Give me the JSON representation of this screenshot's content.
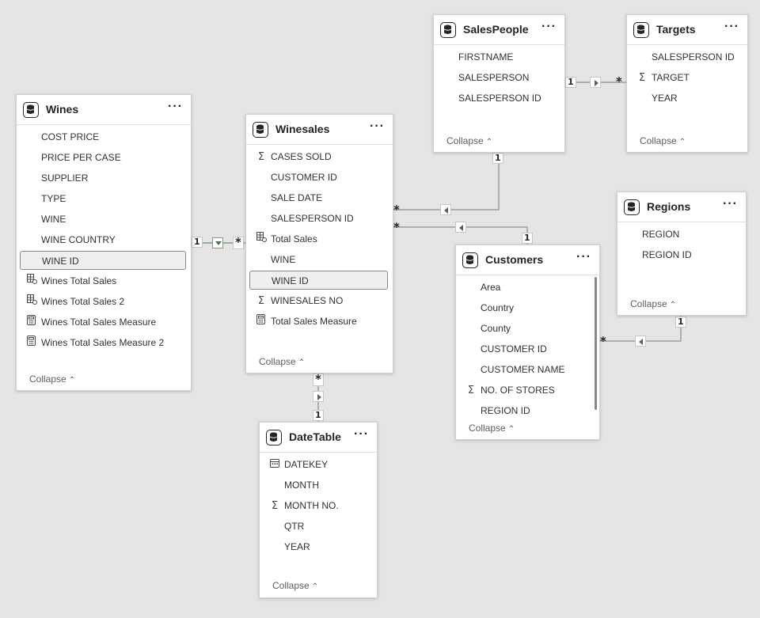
{
  "tables": {
    "wines": {
      "title": "Wines",
      "fields": [
        {
          "label": "COST PRICE",
          "icon": ""
        },
        {
          "label": "PRICE PER CASE",
          "icon": ""
        },
        {
          "label": "SUPPLIER",
          "icon": ""
        },
        {
          "label": "TYPE",
          "icon": ""
        },
        {
          "label": "WINE",
          "icon": ""
        },
        {
          "label": "WINE COUNTRY",
          "icon": ""
        },
        {
          "label": "WINE ID",
          "icon": "",
          "selected": true
        },
        {
          "label": "Wines Total Sales",
          "icon": "calc-column-icon"
        },
        {
          "label": "Wines Total Sales 2",
          "icon": "calc-column-icon"
        },
        {
          "label": "Wines Total Sales Measure",
          "icon": "measure-icon"
        },
        {
          "label": "Wines Total Sales Measure 2",
          "icon": "measure-icon"
        }
      ],
      "collapse": "Collapse"
    },
    "winesales": {
      "title": "Winesales",
      "fields": [
        {
          "label": "CASES SOLD",
          "icon": "sum-icon"
        },
        {
          "label": "CUSTOMER ID",
          "icon": ""
        },
        {
          "label": "SALE DATE",
          "icon": ""
        },
        {
          "label": "SALESPERSON ID",
          "icon": ""
        },
        {
          "label": "Total Sales",
          "icon": "calc-column-icon"
        },
        {
          "label": "WINE",
          "icon": ""
        },
        {
          "label": "WINE ID",
          "icon": "",
          "selected": true
        },
        {
          "label": "WINESALES NO",
          "icon": "sum-icon"
        },
        {
          "label": "Total Sales Measure",
          "icon": "measure-icon"
        }
      ],
      "collapse": "Collapse"
    },
    "salespeople": {
      "title": "SalesPeople",
      "fields": [
        {
          "label": "FIRSTNAME",
          "icon": ""
        },
        {
          "label": "SALESPERSON",
          "icon": ""
        },
        {
          "label": "SALESPERSON ID",
          "icon": ""
        }
      ],
      "collapse": "Collapse"
    },
    "targets": {
      "title": "Targets",
      "fields": [
        {
          "label": "SALESPERSON ID",
          "icon": ""
        },
        {
          "label": "TARGET",
          "icon": "sum-icon"
        },
        {
          "label": "YEAR",
          "icon": ""
        }
      ],
      "collapse": "Collapse"
    },
    "regions": {
      "title": "Regions",
      "fields": [
        {
          "label": "REGION",
          "icon": ""
        },
        {
          "label": "REGION ID",
          "icon": ""
        }
      ],
      "collapse": "Collapse"
    },
    "customers": {
      "title": "Customers",
      "fields": [
        {
          "label": "Area",
          "icon": ""
        },
        {
          "label": "Country",
          "icon": ""
        },
        {
          "label": "County",
          "icon": ""
        },
        {
          "label": "CUSTOMER ID",
          "icon": ""
        },
        {
          "label": "CUSTOMER NAME",
          "icon": ""
        },
        {
          "label": "NO. OF STORES",
          "icon": "sum-icon"
        },
        {
          "label": "REGION ID",
          "icon": ""
        }
      ],
      "collapse": "Collapse"
    },
    "datetable": {
      "title": "DateTable",
      "fields": [
        {
          "label": "DATEKEY",
          "icon": "calendar-icon"
        },
        {
          "label": "MONTH",
          "icon": ""
        },
        {
          "label": "MONTH NO.",
          "icon": "sum-icon"
        },
        {
          "label": "QTR",
          "icon": ""
        },
        {
          "label": "YEAR",
          "icon": ""
        }
      ],
      "collapse": "Collapse"
    }
  },
  "more_label": "···",
  "cardinality": {
    "one": "1",
    "many": "*"
  },
  "colors": {
    "background": "#e6e5e3",
    "line": "#a19f9d",
    "selected_line": "#8a9a8f"
  }
}
